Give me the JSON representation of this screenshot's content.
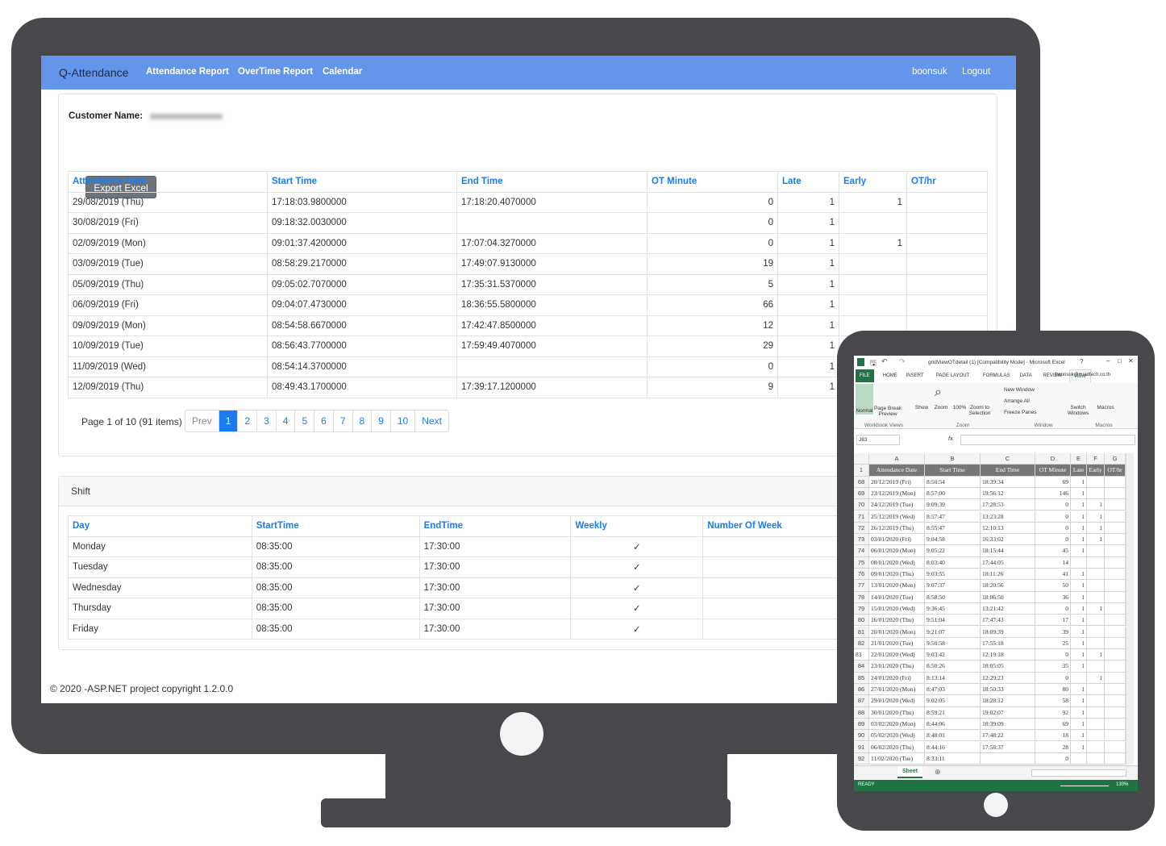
{
  "nav": {
    "brand": "Q-Attendance",
    "links": [
      "Attendance Report",
      "OverTime Report",
      "Calendar"
    ],
    "user": "boonsuk",
    "logout": "Logout",
    "color": "#6395ea"
  },
  "customer": {
    "label": "Customer Name:"
  },
  "export_label": "Export Excel",
  "attendance": {
    "headers": [
      "Attendance Date",
      "Start Time",
      "End Time",
      "OT Minute",
      "Late",
      "Early",
      "OT/hr"
    ],
    "rows": [
      [
        "29/08/2019 (Thu)",
        "17:18:03.9800000",
        "17:18:20.4070000",
        "0",
        "1",
        "1",
        ""
      ],
      [
        "30/08/2019 (Fri)",
        "09:18:32.0030000",
        "",
        "0",
        "1",
        "",
        ""
      ],
      [
        "02/09/2019 (Mon)",
        "09:01:37.4200000",
        "17:07:04.3270000",
        "0",
        "1",
        "1",
        ""
      ],
      [
        "03/09/2019 (Tue)",
        "08:58:29.2170000",
        "17:49:07.9130000",
        "19",
        "1",
        "",
        ""
      ],
      [
        "05/09/2019 (Thu)",
        "09:05:02.7070000",
        "17:35:31.5370000",
        "5",
        "1",
        "",
        ""
      ],
      [
        "06/09/2019 (Fri)",
        "09:04:07.4730000",
        "18:36:55.5800000",
        "66",
        "1",
        "",
        ""
      ],
      [
        "09/09/2019 (Mon)",
        "08:54:58.6670000",
        "17:42:47.8500000",
        "12",
        "1",
        "",
        ""
      ],
      [
        "10/09/2019 (Tue)",
        "08:56:43.7700000",
        "17:59:49.4070000",
        "29",
        "1",
        "",
        ""
      ],
      [
        "11/09/2019 (Wed)",
        "08:54:14.3700000",
        "",
        "0",
        "1",
        "",
        ""
      ],
      [
        "12/09/2019 (Thu)",
        "08:49:43.1700000",
        "17:39:17.1200000",
        "9",
        "1",
        "",
        ""
      ]
    ]
  },
  "pager": {
    "summary": "Page 1 of 10 (91 items)",
    "items": [
      "Prev",
      "1",
      "2",
      "3",
      "4",
      "5",
      "6",
      "7",
      "8",
      "9",
      "10",
      "Next"
    ],
    "current": "1"
  },
  "shift": {
    "title": "Shift",
    "headers": [
      "Day",
      "StartTime",
      "EndTime",
      "Weekly",
      "Number Of Week"
    ],
    "rows": [
      [
        "Monday",
        "08:35:00",
        "17:30:00",
        "✓",
        ""
      ],
      [
        "Tuesday",
        "08:35:00",
        "17:30:00",
        "✓",
        ""
      ],
      [
        "Wednesday",
        "08:35:00",
        "17:30:00",
        "✓",
        ""
      ],
      [
        "Thursday",
        "08:35:00",
        "17:30:00",
        "✓",
        ""
      ],
      [
        "Friday",
        "08:35:00",
        "17:30:00",
        "✓",
        ""
      ]
    ]
  },
  "footer": "© 2020 -ASP.NET project copyright 1.2.0.0",
  "excel": {
    "title": "gridViewOTdetail (1)  [Compatibility Mode] - Microsoft Excel",
    "tabs": [
      "FILE",
      "HOME",
      "INSERT",
      "PAGE LAYOUT",
      "FORMULAS",
      "DATA",
      "REVIEW",
      "VIEW"
    ],
    "active_tab": "VIEW",
    "account": "boonsuk@quadtech.co.th",
    "ribbon": {
      "normal": "Normal",
      "page_break": "Page Break Preview",
      "show": "Show",
      "zoom": "Zoom",
      "zoom100": "100%",
      "zoom_sel": "Zoom to Selection",
      "new_window": "New Window",
      "arrange_all": "Arrange All",
      "freeze": "Freeze Panes",
      "switch": "Switch Windows",
      "macros": "Macros",
      "groups": [
        "Workbook Views",
        "Zoom",
        "Window",
        "Macros"
      ]
    },
    "name_box": "J83",
    "fx": "fx",
    "col_letters": [
      "A",
      "B",
      "C",
      "D",
      "E",
      "F",
      "G"
    ],
    "header_row": "1",
    "headers": [
      "Attendance Date",
      "Start Time",
      "End Time",
      "OT Minute",
      "Late",
      "Early",
      "OT/hr"
    ],
    "rows": [
      [
        "68",
        "20/12/2019 (Fri)",
        "8:50:54",
        "18:39:34",
        "69",
        "1",
        ""
      ],
      [
        "69",
        "23/12/2019 (Mon)",
        "8:57:00",
        "19:56:12",
        "146",
        "1",
        ""
      ],
      [
        "70",
        "24/12/2019 (Tue)",
        "9:09:39",
        "17:28:53",
        "0",
        "1",
        "1"
      ],
      [
        "71",
        "25/12/2019 (Wed)",
        "8:57:47",
        "13:23:28",
        "0",
        "1",
        "1"
      ],
      [
        "72",
        "26/12/2019 (Thu)",
        "8:55:47",
        "12:10:13",
        "0",
        "1",
        "1"
      ],
      [
        "73",
        "03/01/2020 (Fri)",
        "9:04:58",
        "16:33:02",
        "0",
        "1",
        "1"
      ],
      [
        "74",
        "06/01/2020 (Mon)",
        "9:05:22",
        "18:15:44",
        "45",
        "1",
        ""
      ],
      [
        "75",
        "08/01/2020 (Wed)",
        "8:03:40",
        "17:44:05",
        "14",
        "",
        ""
      ],
      [
        "76",
        "09/01/2020 (Thu)",
        "9:03:55",
        "18:11:26",
        "41",
        "1",
        ""
      ],
      [
        "77",
        "13/01/2020 (Mon)",
        "9:07:37",
        "18:20:56",
        "50",
        "1",
        ""
      ],
      [
        "78",
        "14/01/2020 (Tue)",
        "8:58:50",
        "18:06:50",
        "36",
        "1",
        ""
      ],
      [
        "79",
        "15/01/2020 (Wed)",
        "9:36:45",
        "13:21:42",
        "0",
        "1",
        "1"
      ],
      [
        "80",
        "16/01/2020 (Thu)",
        "9:51:04",
        "17:47:43",
        "17",
        "1",
        ""
      ],
      [
        "81",
        "20/01/2020 (Mon)",
        "9:21:07",
        "18:09:39",
        "39",
        "1",
        ""
      ],
      [
        "82",
        "21/01/2020 (Tue)",
        "9:50:58",
        "17:55:18",
        "25",
        "1",
        ""
      ],
      [
        "83",
        "22/01/2020 (Wed)",
        "9:03:42",
        "12:19:18",
        "0",
        "1",
        "1"
      ],
      [
        "84",
        "23/01/2020 (Thu)",
        "8:50:26",
        "18:05:05",
        "35",
        "1",
        ""
      ],
      [
        "85",
        "24/01/2020 (Fri)",
        "8:13:14",
        "12:29:23",
        "0",
        "",
        "1"
      ],
      [
        "86",
        "27/01/2020 (Mon)",
        "8:47:03",
        "18:50:33",
        "80",
        "1",
        ""
      ],
      [
        "87",
        "29/01/2020 (Wed)",
        "9:02:05",
        "18:28:12",
        "58",
        "1",
        ""
      ],
      [
        "88",
        "30/01/2020 (Thu)",
        "8:59:21",
        "19:02:07",
        "92",
        "1",
        ""
      ],
      [
        "89",
        "03/02/2020 (Mon)",
        "8:44:06",
        "18:39:09",
        "69",
        "1",
        ""
      ],
      [
        "90",
        "05/02/2020 (Wed)",
        "8:48:01",
        "17:48:22",
        "18",
        "1",
        ""
      ],
      [
        "91",
        "06/02/2020 (Thu)",
        "8:44:16",
        "17:58:37",
        "28",
        "1",
        ""
      ],
      [
        "92",
        "11/02/2020 (Tue)",
        "8:33:11",
        "",
        "0",
        "",
        ""
      ]
    ],
    "sheet_tab": "Sheet",
    "status": "READY",
    "zoom_level": "130%",
    "green": "#217346"
  }
}
